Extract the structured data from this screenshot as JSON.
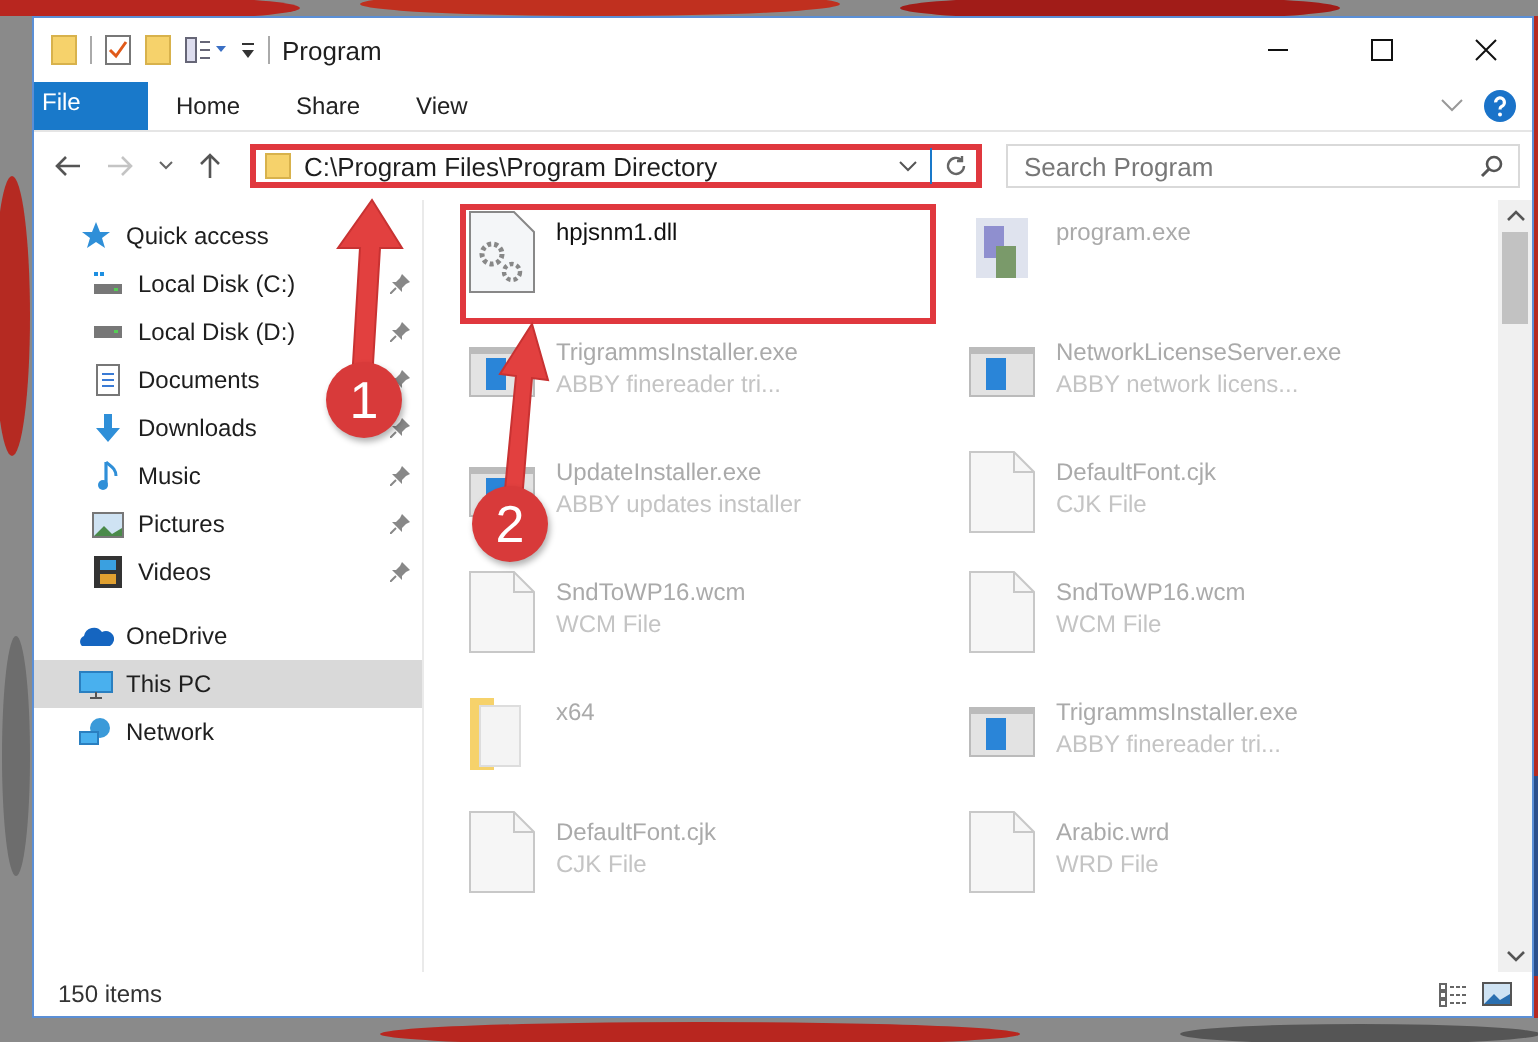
{
  "window": {
    "title": "Program"
  },
  "ribbon_tabs": [
    {
      "label": "File",
      "selected": true
    },
    {
      "label": "Home",
      "selected": false
    },
    {
      "label": "Share",
      "selected": false
    },
    {
      "label": "View",
      "selected": false
    }
  ],
  "address": {
    "value": "C:\\Program Files\\Program Directory",
    "highlighted": true
  },
  "search": {
    "placeholder": "Search Program"
  },
  "sidebar": {
    "items": [
      {
        "label": "Quick access",
        "kind": "star",
        "selected": false,
        "children": [
          {
            "label": "Local Disk (C:)",
            "kind": "system-drive",
            "pinned": true,
            "selected": false
          },
          {
            "label": "Local Disk (D:)",
            "kind": "drive",
            "pinned": true,
            "selected": false
          },
          {
            "label": "Documents",
            "kind": "document",
            "pinned": true,
            "selected": false
          },
          {
            "label": "Downloads",
            "kind": "download",
            "pinned": true,
            "selected": false
          },
          {
            "label": "Music",
            "kind": "music",
            "pinned": true,
            "selected": false
          },
          {
            "label": "Pictures",
            "kind": "pictures",
            "pinned": true,
            "selected": false
          },
          {
            "label": "Videos",
            "kind": "videos",
            "pinned": true,
            "selected": false
          }
        ]
      },
      {
        "label": "OneDrive",
        "kind": "cloud",
        "selected": false
      },
      {
        "label": "This PC",
        "kind": "computer",
        "selected": true
      },
      {
        "label": "Network",
        "kind": "network",
        "selected": false
      }
    ]
  },
  "files": [
    {
      "name": "hpjsnm1.dll",
      "kind": "settings-file",
      "highlighted": true
    },
    {
      "name": "program.exe",
      "kind": "app",
      "highlighted": false
    },
    {
      "name": "TrigrammsInstaller.exe",
      "type": "ABBY finereader tri...",
      "kind": "installer",
      "highlighted": false
    },
    {
      "name": "NetworkLicenseServer.exe",
      "type": "ABBY network licens...",
      "kind": "installer",
      "highlighted": false
    },
    {
      "name": "UpdateInstaller.exe",
      "type": "ABBY updates installer",
      "kind": "installer",
      "highlighted": false
    },
    {
      "name": "DefaultFont.cjk",
      "type": "CJK File",
      "kind": "blank",
      "highlighted": false
    },
    {
      "name": "SndToWP16.wcm",
      "type": "WCM File",
      "kind": "blank",
      "highlighted": false
    },
    {
      "name": "SndToWP16.wcm",
      "type": "WCM File",
      "kind": "blank",
      "highlighted": false
    },
    {
      "name": "x64",
      "kind": "folder",
      "highlighted": false
    },
    {
      "name": "TrigrammsInstaller.exe",
      "type": "ABBY finereader tri...",
      "kind": "installer",
      "highlighted": false
    },
    {
      "name": "DefaultFont.cjk",
      "type": "CJK File",
      "kind": "blank",
      "highlighted": false
    },
    {
      "name": "Arabic.wrd",
      "type": "WRD File",
      "kind": "blank",
      "highlighted": false
    }
  ],
  "status_bar": {
    "item_count": "150 items"
  },
  "annotations": [
    {
      "number": "1",
      "kind": "arrow"
    },
    {
      "number": "2",
      "kind": "arrow"
    }
  ]
}
